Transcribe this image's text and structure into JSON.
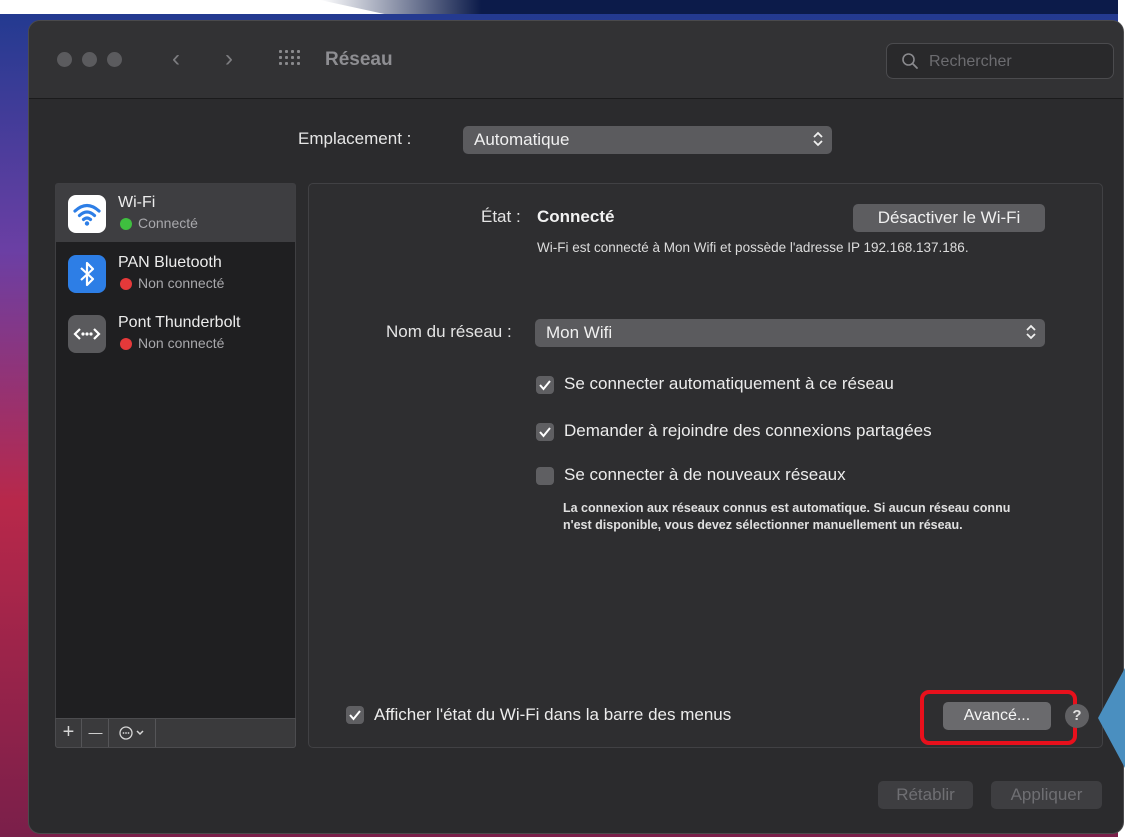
{
  "window": {
    "title": "Réseau"
  },
  "search": {
    "placeholder": "Rechercher"
  },
  "location": {
    "label": "Emplacement :",
    "value": "Automatique"
  },
  "sidebar": {
    "items": [
      {
        "name": "Wi-Fi",
        "status": "Connecté",
        "status_color": "#3fbf3f",
        "icon": "wifi-icon",
        "icon_bg": "#ffffff"
      },
      {
        "name": "PAN Bluetooth",
        "status": "Non connecté",
        "status_color": "#e5393a",
        "icon": "bluetooth-icon",
        "icon_bg": "#2d7ee6"
      },
      {
        "name": "Pont Thunderbolt",
        "status": "Non connecté",
        "status_color": "#e5393a",
        "icon": "thunderbolt-bridge-icon",
        "icon_bg": "#d4d4d6"
      }
    ],
    "toolbar": {
      "add": "+",
      "remove": "—"
    }
  },
  "detail": {
    "status_label": "État :",
    "status_value": "Connecté",
    "disable_button": "Désactiver le Wi-Fi",
    "status_description": "Wi-Fi est connecté à Mon Wifi et possède l'adresse IP 192.168.137.186.",
    "network_name_label": "Nom du réseau :",
    "network_name_value": "Mon Wifi",
    "checkboxes": [
      {
        "label": "Se connecter automatiquement à ce réseau",
        "checked": true
      },
      {
        "label": "Demander à rejoindre des connexions partagées",
        "checked": true
      },
      {
        "label": "Se connecter à de nouveaux réseaux",
        "checked": false
      }
    ],
    "note": "La connexion aux réseaux connus est automatique. Si aucun réseau connu n'est disponible, vous devez sélectionner manuellement un réseau.",
    "menubar_checkbox": {
      "label": "Afficher l'état du Wi-Fi dans la barre des menus",
      "checked": true
    },
    "advanced_button": "Avancé...",
    "help_button": "?"
  },
  "footer": {
    "revert_button": "Rétablir",
    "apply_button": "Appliquer"
  },
  "colors": {
    "highlight": "#e8101c",
    "window_bg": "#2b2b2d",
    "accent_callout": "#4a8fc0"
  }
}
